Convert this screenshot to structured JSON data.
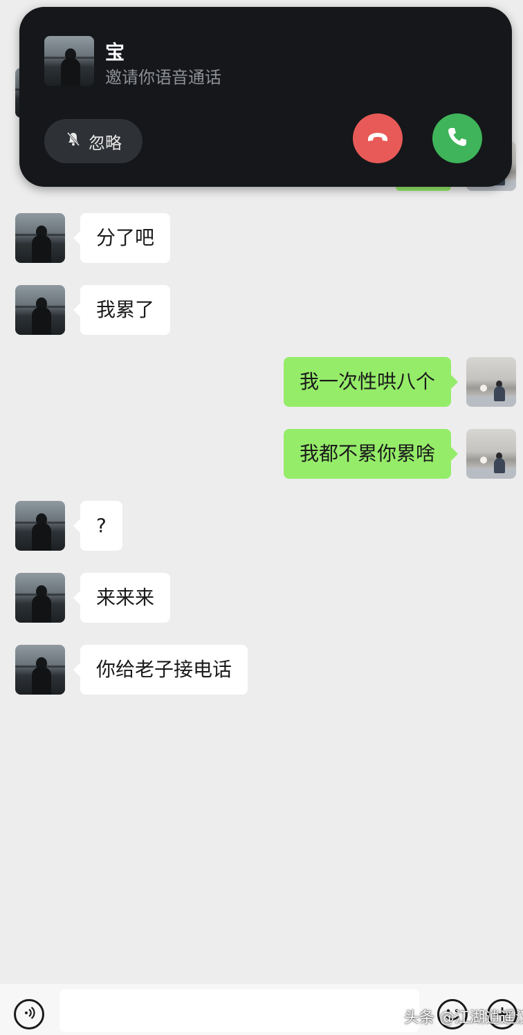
{
  "call_banner": {
    "caller_name": "宝",
    "status_text": "邀请你语音通话",
    "ignore_label": "忽略",
    "decline_icon": "phone-hangup-icon",
    "accept_icon": "phone-icon",
    "colors": {
      "background": "#15171a",
      "decline": "#e85a57",
      "accept": "#3fb45a"
    }
  },
  "messages": [
    {
      "sender": "other",
      "text": "分了吧"
    },
    {
      "sender": "other",
      "text": "我累了"
    },
    {
      "sender": "me",
      "text": "我一次性哄八个"
    },
    {
      "sender": "me",
      "text": "我都不累你累啥"
    },
    {
      "sender": "other",
      "text": "?"
    },
    {
      "sender": "other",
      "text": "来来来"
    },
    {
      "sender": "other",
      "text": "你给老子接电话"
    }
  ],
  "input_bar": {
    "voice_icon": "voice-toggle-icon",
    "emoji_icon": "emoji-icon",
    "more_icon": "plus-icon"
  },
  "watermark": "头条 @江湖逍遥汉",
  "colors": {
    "chat_background": "#ededed",
    "bubble_me": "#95ec69",
    "bubble_other": "#ffffff"
  }
}
